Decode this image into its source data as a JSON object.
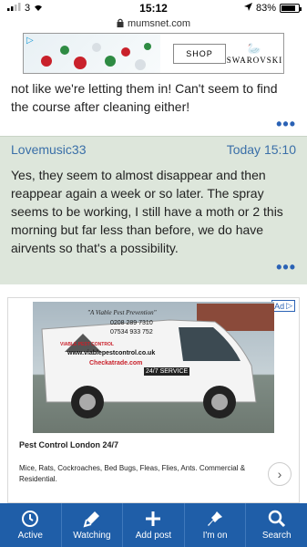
{
  "status": {
    "signal": "3",
    "time": "15:12",
    "battery_percent": "83%",
    "battery_level": 0.83,
    "url": "mumsnet.com"
  },
  "top_ad": {
    "shop_label": "SHOP",
    "brand": "SWAROVSKI"
  },
  "post_prev": {
    "text": "not like we're letting them in! Can't seem to find the course after cleaning either!"
  },
  "post": {
    "author": "Lovemusic33",
    "timestamp": "Today 15:10",
    "body": "Yes, they seem to almost disappear and then reappear again a week or so later. The spray seems to be working, I still have a moth or 2 this morning but far less than before, we do have airvents so that's a possibility."
  },
  "ad": {
    "tag": "Ad",
    "slogan": "\"A Viable Pest Prevention\"",
    "logo_text": "VIABLE PEST CONTROL",
    "phone1": "0208 289 7310",
    "phone2": "07534 933 752",
    "website": "www.viablepestcontrol.co.uk",
    "checkatrade": "Checkatrade.com",
    "service": "24/7 SERVICE",
    "title": "Pest Control London 24/7",
    "description": "Mice, Rats, Cockroaches, Bed Bugs, Fleas, Flies, Ants. Commercial & Residential."
  },
  "nav": [
    {
      "label": "Active",
      "icon": "clock-icon"
    },
    {
      "label": "Watching",
      "icon": "flashlight-icon"
    },
    {
      "label": "Add post",
      "icon": "plus-icon"
    },
    {
      "label": "I'm on",
      "icon": "pin-icon"
    },
    {
      "label": "Search",
      "icon": "search-icon"
    }
  ]
}
